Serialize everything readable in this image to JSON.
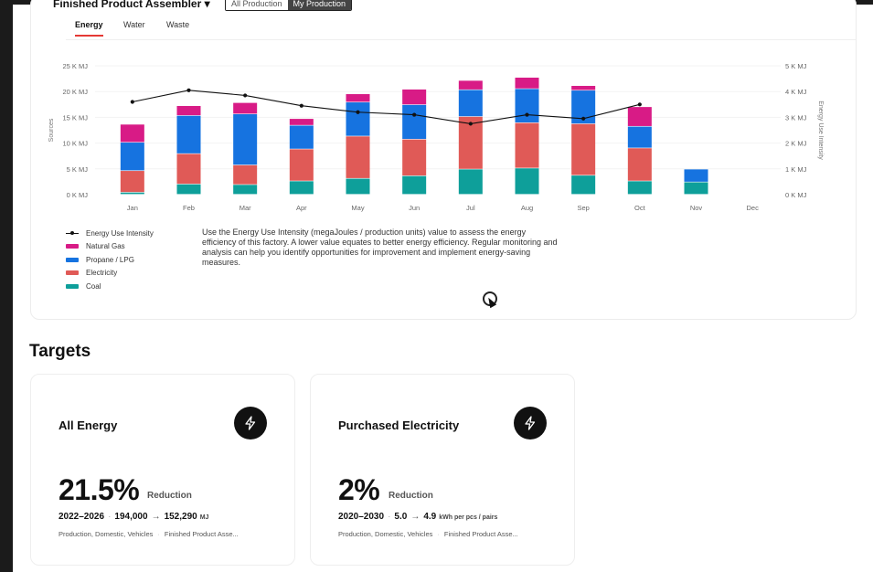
{
  "filters": {
    "product": "Finished Product Assembler",
    "scope_options": [
      "All Production",
      "My Production"
    ],
    "scope_selected": "My Production"
  },
  "tabs": [
    {
      "label": "Energy",
      "active": true
    },
    {
      "label": "Water",
      "active": false
    },
    {
      "label": "Waste",
      "active": false
    }
  ],
  "chart_data": {
    "type": "bar",
    "stacked": true,
    "categories": [
      "Jan",
      "Feb",
      "Mar",
      "Apr",
      "May",
      "Jun",
      "Jul",
      "Aug",
      "Sep",
      "Oct",
      "Nov",
      "Dec"
    ],
    "series": [
      {
        "name": "Coal",
        "color": "#0e9f9a",
        "values": [
          400,
          2000,
          1900,
          2600,
          3100,
          3600,
          4900,
          5100,
          3700,
          2600,
          2400,
          0
        ]
      },
      {
        "name": "Electricity",
        "color": "#e05a57",
        "values": [
          4200,
          5900,
          3800,
          6200,
          8200,
          7100,
          10200,
          8800,
          10000,
          6400,
          0,
          0
        ]
      },
      {
        "name": "Propane / LPG",
        "color": "#1673e0",
        "values": [
          5500,
          7400,
          9900,
          4600,
          6600,
          6700,
          5200,
          6600,
          6500,
          4200,
          2500,
          0
        ]
      },
      {
        "name": "Natural Gas",
        "color": "#d81b86",
        "values": [
          3500,
          1900,
          2200,
          1300,
          1600,
          3000,
          1800,
          2200,
          900,
          3800,
          0,
          0
        ]
      }
    ],
    "line": {
      "name": "Energy Use Intensity",
      "color": "#111111",
      "values": [
        3.6,
        4.05,
        3.85,
        3.45,
        3.2,
        3.1,
        2.75,
        3.1,
        2.95,
        3.5,
        null,
        null
      ]
    },
    "y_left": {
      "label": "Sources",
      "ticks": [
        "0 K MJ",
        "5 K MJ",
        "10 K MJ",
        "15 K MJ",
        "20 K MJ",
        "25 K MJ"
      ],
      "ylim": [
        0,
        25000
      ]
    },
    "y_right": {
      "label": "Energy Use Intensity",
      "ticks": [
        "0 K MJ",
        "1 K MJ",
        "2 K MJ",
        "3 K MJ",
        "4 K MJ",
        "5 K MJ"
      ],
      "ylim": [
        0,
        5
      ]
    },
    "legend": [
      "Energy Use Intensity",
      "Natural Gas",
      "Propane / LPG",
      "Electricity",
      "Coal"
    ],
    "legend_position": "bottom-left",
    "grid": true
  },
  "description": "Use the Energy Use Intensity (megaJoules / production units) value to assess the energy efficiency of this factory. A lower value equates to better energy efficiency. Regular monitoring and analysis can help you identify opportunities for improvement and implement energy-saving measures.",
  "targets": {
    "title": "Targets",
    "cards": [
      {
        "title": "All Energy",
        "icon": "bolt-icon",
        "value": "21.5%",
        "label": "Reduction",
        "period": "2022–2026",
        "from": "194,000",
        "to": "152,290",
        "unit": "MJ",
        "tags": "Production, Domestic, Vehicles",
        "product": "Finished Product Asse..."
      },
      {
        "title": "Purchased Electricity",
        "icon": "bolt-icon",
        "value": "2%",
        "label": "Reduction",
        "period": "2020–2030",
        "from": "5.0",
        "to": "4.9",
        "unit": "kWh per pcs / pairs",
        "tags": "Production, Domestic, Vehicles",
        "product": "Finished Product Asse..."
      }
    ]
  }
}
